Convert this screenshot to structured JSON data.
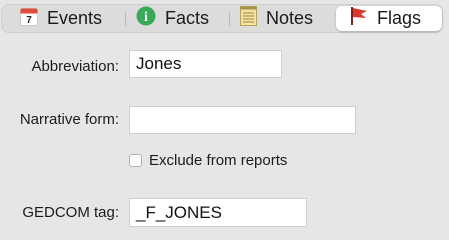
{
  "tabs": [
    {
      "label": "Events",
      "icon": "calendar-icon",
      "calendar_day": "7"
    },
    {
      "label": "Facts",
      "icon": "info-icon",
      "glyph": "i"
    },
    {
      "label": "Notes",
      "icon": "notepad-icon"
    },
    {
      "label": "Flags",
      "icon": "flag-icon",
      "selected": true
    }
  ],
  "form": {
    "abbreviation_label": "Abbreviation:",
    "abbreviation_value": "Jones",
    "narrative_label": "Narrative form:",
    "narrative_value": "",
    "exclude_label": "Exclude from reports",
    "exclude_checked": false,
    "gedcom_label": "GEDCOM tag:",
    "gedcom_value": "_F_JONES"
  },
  "colors": {
    "background": "#e6e6e6",
    "selected_tab": "#ffffff",
    "flag_red": "#d7382c",
    "info_green": "#3aa859",
    "calendar_red": "#e24a3b"
  }
}
